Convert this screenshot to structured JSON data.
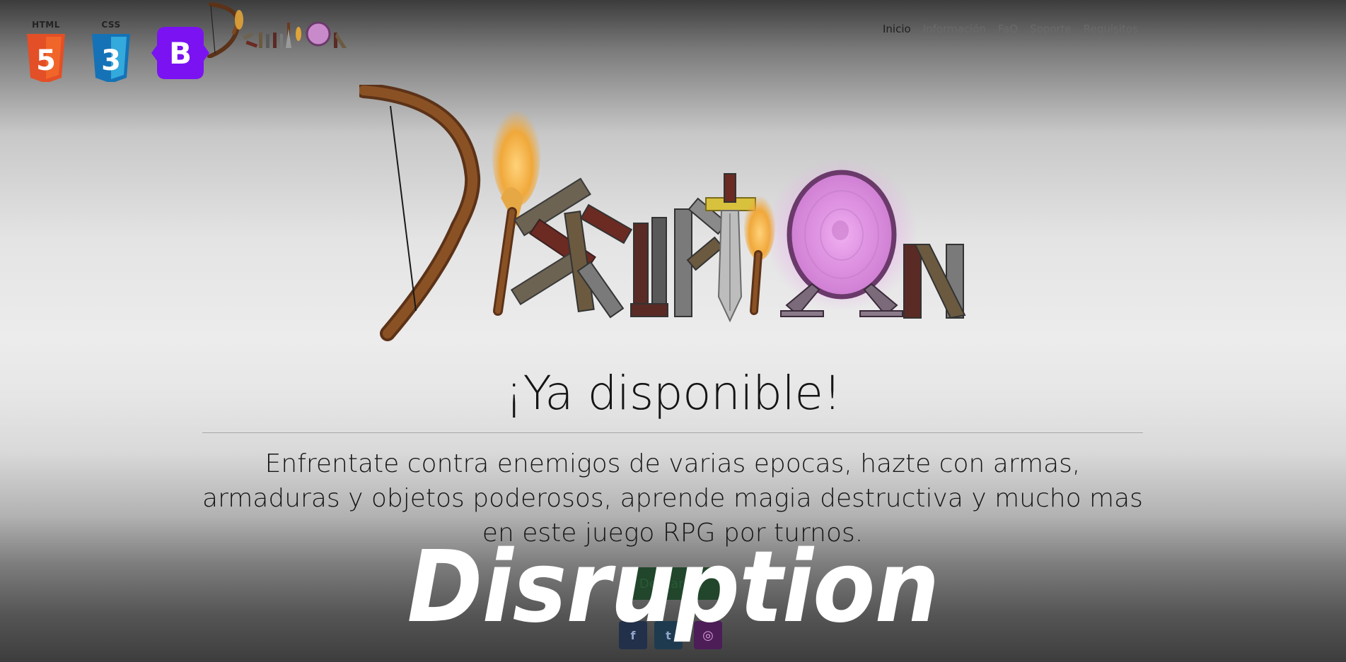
{
  "tech_badges": {
    "html_label": "HTML",
    "html_glyph": "5",
    "css_label": "CSS",
    "css_glyph": "3",
    "bootstrap_glyph": "B"
  },
  "nav": {
    "items": [
      {
        "label": "Inicio",
        "active": true
      },
      {
        "label": "Información",
        "active": false
      },
      {
        "label": "FaQ",
        "active": false
      },
      {
        "label": "Soporte",
        "active": false
      },
      {
        "label": "Requisitos",
        "active": false
      }
    ]
  },
  "hero": {
    "headline": "¡Ya disponible!",
    "lead": "Enfrentate contra enemigos de varias epocas, hazte con armas, armaduras y objetos poderosos, aprende magia destructiva y mucho mas en este juego RPG por turnos.",
    "cta_label": "Descargar"
  },
  "social": {
    "icons": [
      "facebook-icon",
      "twitter-icon",
      "instagram-icon"
    ],
    "facebook_glyph": "f",
    "twitter_glyph": "t",
    "instagram_glyph": "◎"
  },
  "watermark": "Disruption",
  "colors": {
    "html_orange": "#e34f26",
    "css_blue": "#2965f1",
    "bootstrap_purple": "#7b12f2",
    "cta_green": "#21462b",
    "portal_pink": "#dd8fe0",
    "wood_brown": "#6b3a1d"
  }
}
